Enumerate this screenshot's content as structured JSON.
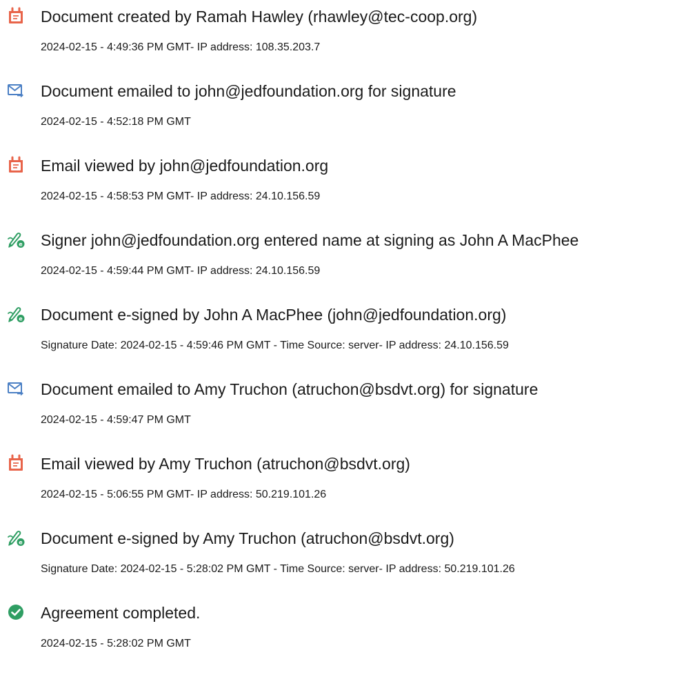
{
  "events": [
    {
      "icon": "document-created-icon",
      "title": "Document created by Ramah Hawley (rhawley@tec-coop.org)",
      "detail": "2024-02-15 - 4:49:36 PM GMT- IP address: 108.35.203.7"
    },
    {
      "icon": "email-sent-icon",
      "title": "Document emailed to john@jedfoundation.org for signature",
      "detail": "2024-02-15 - 4:52:18 PM GMT"
    },
    {
      "icon": "document-viewed-icon",
      "title": "Email viewed by john@jedfoundation.org",
      "detail": "2024-02-15 - 4:58:53 PM GMT- IP address: 24.10.156.59"
    },
    {
      "icon": "e-sign-pen-icon",
      "title": "Signer john@jedfoundation.org entered name at signing as John A MacPhee",
      "detail": "2024-02-15 - 4:59:44 PM GMT- IP address: 24.10.156.59"
    },
    {
      "icon": "e-sign-pen-icon",
      "title": "Document e-signed by John A MacPhee (john@jedfoundation.org)",
      "detail": "Signature Date: 2024-02-15 - 4:59:46 PM GMT - Time Source: server- IP address: 24.10.156.59"
    },
    {
      "icon": "email-sent-icon",
      "title": "Document emailed to Amy Truchon (atruchon@bsdvt.org) for signature",
      "detail": "2024-02-15 - 4:59:47 PM GMT"
    },
    {
      "icon": "document-viewed-icon",
      "title": "Email viewed by Amy Truchon (atruchon@bsdvt.org)",
      "detail": "2024-02-15 - 5:06:55 PM GMT- IP address: 50.219.101.26"
    },
    {
      "icon": "e-sign-pen-icon",
      "title": "Document e-signed by Amy Truchon (atruchon@bsdvt.org)",
      "detail": "Signature Date: 2024-02-15 - 5:28:02 PM GMT - Time Source: server- IP address: 50.219.101.26"
    },
    {
      "icon": "agreement-completed-icon",
      "title": "Agreement completed.",
      "detail": "2024-02-15 - 5:28:02 PM GMT"
    }
  ],
  "colors": {
    "doc_icon": "#e8644a",
    "email_icon": "#4a7fc4",
    "pen_icon": "#2f9e63",
    "check_icon": "#2f9e63",
    "text": "#1a1a1a"
  }
}
